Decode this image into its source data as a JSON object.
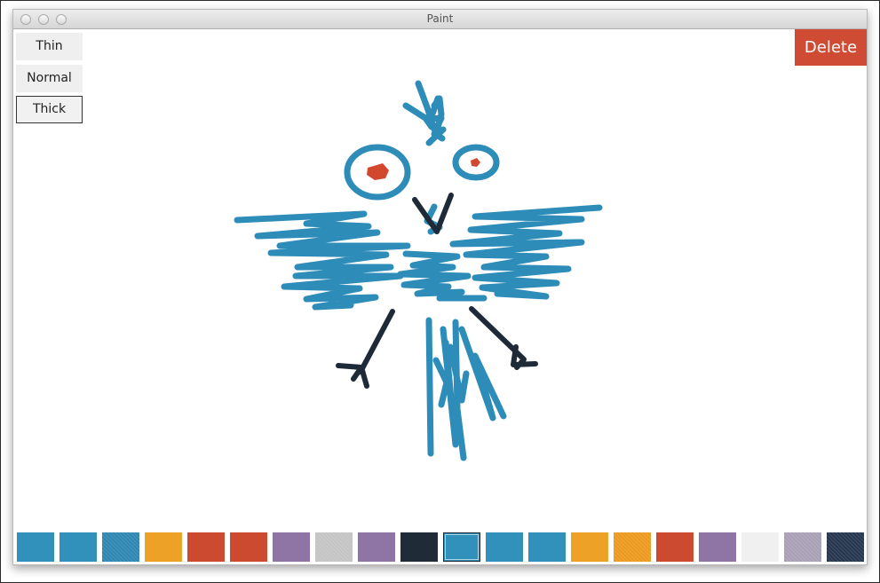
{
  "window": {
    "title": "Paint"
  },
  "toolbar": {
    "brush_sizes": [
      {
        "label": "Thin",
        "selected": false
      },
      {
        "label": "Normal",
        "selected": false
      },
      {
        "label": "Thick",
        "selected": true
      }
    ],
    "delete_label": "Delete"
  },
  "colors": {
    "delete_button": "#cf4b33",
    "drawing_blue": "#2e8cb8",
    "drawing_dark": "#1e2a38",
    "drawing_red": "#d2482e"
  },
  "palette": {
    "swatches": [
      {
        "color": "#3191bb"
      },
      {
        "color": "#3191bb"
      },
      {
        "color": "#2e86b2",
        "textured": true
      },
      {
        "color": "#eda227"
      },
      {
        "color": "#cc4a30"
      },
      {
        "color": "#cc4a30"
      },
      {
        "color": "#8f74a6"
      },
      {
        "color": "#c4c4c4",
        "textured": true
      },
      {
        "color": "#8f74a6"
      },
      {
        "color": "#1f2b37"
      },
      {
        "color": "#3191bb",
        "selected": true
      },
      {
        "color": "#3191bb"
      },
      {
        "color": "#3191bb"
      },
      {
        "color": "#eda227"
      },
      {
        "color": "#ec9a1f",
        "textured": true
      },
      {
        "color": "#cc4a30"
      },
      {
        "color": "#8f74a6"
      },
      {
        "color": "#f0f0f0"
      },
      {
        "color": "#aaa0b6",
        "textured": true
      },
      {
        "color": "#25364f",
        "textured": true
      }
    ]
  }
}
